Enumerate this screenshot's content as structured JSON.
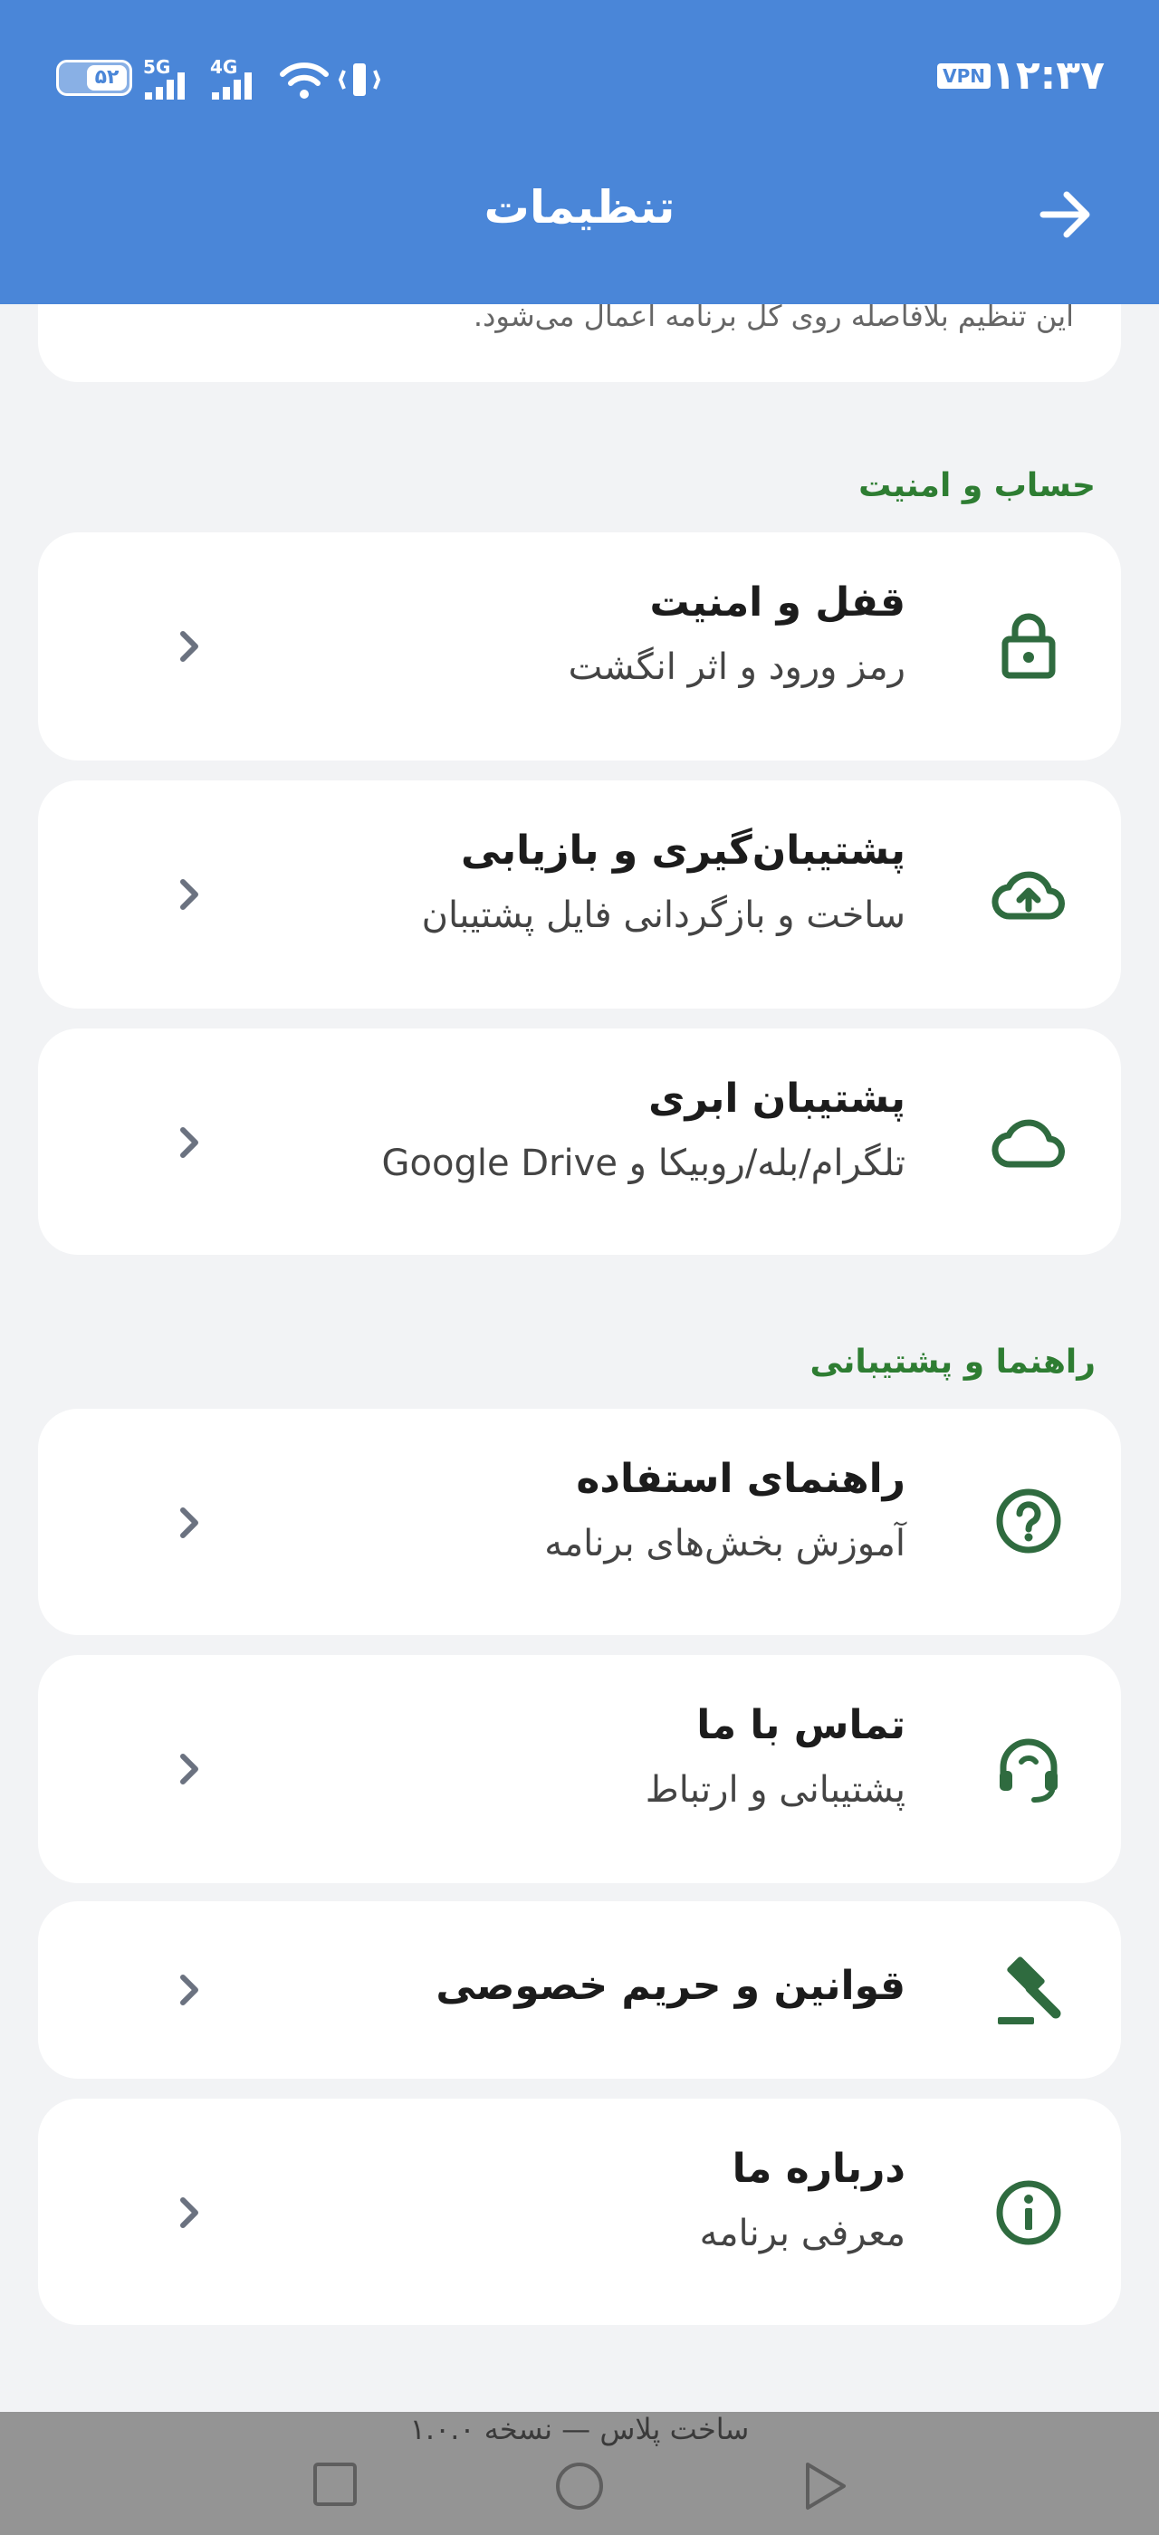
{
  "status_bar": {
    "time": "۱۲:۳۷",
    "vpn": "VPN",
    "battery": "۵۲",
    "net_labels": [
      "5G",
      "4G"
    ]
  },
  "header": {
    "title": "تنظیمات",
    "back_icon": "arrow-right-icon"
  },
  "top_card": {
    "description": "این تنظیم بلافاصله روی کل برنامه اعمال می‌شود."
  },
  "sections": [
    {
      "title": "حساب و امنیت",
      "items": [
        {
          "title": "قفل و امنیت",
          "subtitle": "رمز ورود و اثر انگشت",
          "icon": "lock-icon"
        },
        {
          "title": "پشتیبان‌گیری و بازیابی",
          "subtitle": "ساخت و بازگردانی فایل پشتیبان",
          "icon": "cloud-upload-icon"
        },
        {
          "title": "پشتیبان ابری",
          "subtitle": "تلگرام/بله/روبیکا و Google Drive",
          "icon": "cloud-icon"
        }
      ]
    },
    {
      "title": "راهنما و پشتیبانی",
      "items": [
        {
          "title": "راهنمای استفاده",
          "subtitle": "آموزش بخش‌های برنامه",
          "icon": "help-icon"
        },
        {
          "title": "تماس با ما",
          "subtitle": "پشتیبانی و ارتباط",
          "icon": "headset-icon"
        },
        {
          "title": "قوانین و حریم خصوصی",
          "subtitle": "",
          "icon": "gavel-icon"
        },
        {
          "title": "درباره ما",
          "subtitle": "معرفی برنامه",
          "icon": "info-icon"
        }
      ]
    }
  ],
  "footer": {
    "version": "ساخت پلاس — نسخه ۱.۰.۰"
  },
  "colors": {
    "header": "#4a86d8",
    "accent_green": "#2e7d32",
    "icon_green": "#2f6b3f",
    "chevron": "#6b7280"
  }
}
